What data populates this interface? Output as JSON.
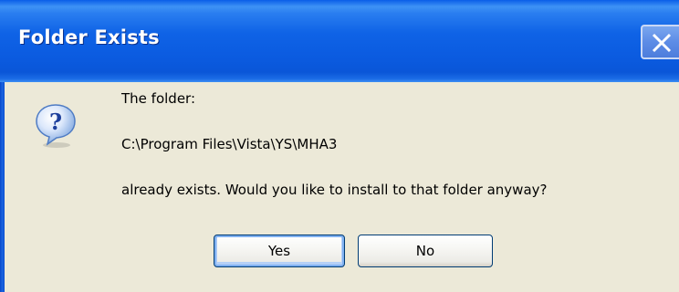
{
  "window": {
    "title": "Folder Exists",
    "close_label": "×"
  },
  "message": {
    "line1": "The folder:",
    "path": "C:\\Program Files\\Vista\\YS\\MHA3",
    "line3": "already exists. Would you like to install to that folder anyway?"
  },
  "buttons": {
    "yes_label": "Yes",
    "no_label": "No"
  },
  "icons": {
    "dialog_icon": "question-icon",
    "close_icon": "close-icon"
  },
  "colors": {
    "titlebar": "#0a5ee8",
    "dialog_bg": "#ece9d8",
    "button_border": "#003c74"
  }
}
